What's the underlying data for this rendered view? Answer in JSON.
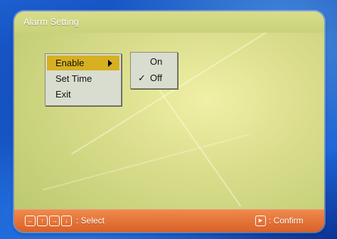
{
  "window": {
    "title": "Alarm Setting"
  },
  "menu": {
    "items": [
      {
        "label": "Enable",
        "selected": true,
        "has_submenu": true
      },
      {
        "label": "Set Time",
        "selected": false
      },
      {
        "label": "Exit",
        "selected": false
      }
    ]
  },
  "submenu": {
    "items": [
      {
        "label": "On",
        "checked": false
      },
      {
        "label": "Off",
        "checked": true
      }
    ],
    "check_glyph": "✓"
  },
  "footer": {
    "keys": [
      "←",
      "↑",
      "→",
      "↓"
    ],
    "select_label": ": Select",
    "confirm_key": "▶",
    "confirm_label": ": Confirm"
  },
  "colors": {
    "highlight": "#d7b021",
    "footer": "#e8743a",
    "panel": "#d6dc88",
    "background": "#1d5fd0"
  }
}
